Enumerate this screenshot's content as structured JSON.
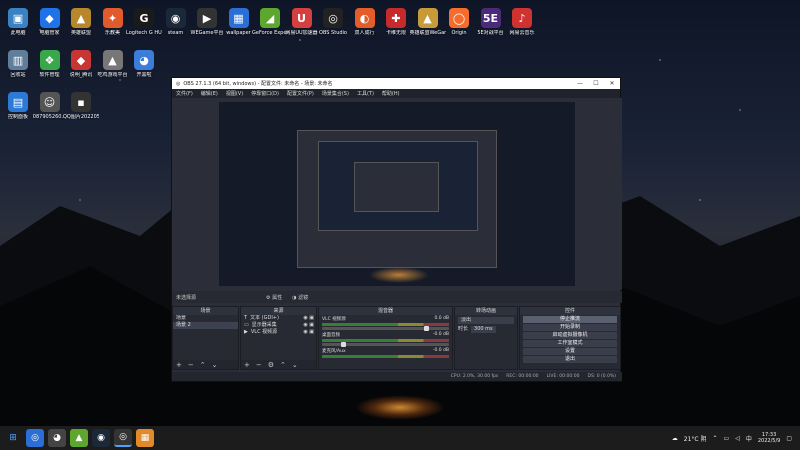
{
  "desktop": {
    "icons_row1": [
      {
        "label": "此电脑",
        "glyph": "▣",
        "color": "#3b82c4"
      },
      {
        "label": "电脑管家",
        "glyph": "◆",
        "color": "#1e73e8"
      },
      {
        "label": "英雄联盟",
        "glyph": "▲",
        "color": "#b8862b"
      },
      {
        "label": "乐教美",
        "glyph": "✦",
        "color": "#e05a2b"
      },
      {
        "label": "Logitech G HUB",
        "glyph": "G",
        "color": "#1a1a1a"
      },
      {
        "label": "steam",
        "glyph": "◉",
        "color": "#1b2838"
      },
      {
        "label": "WEGame平台",
        "glyph": "▶",
        "color": "#333"
      },
      {
        "label": "wallpaper",
        "glyph": "▦",
        "color": "#2b6fd6"
      },
      {
        "label": "GeForce Experience",
        "glyph": "◢",
        "color": "#5da72e"
      },
      {
        "label": "网易UU加速器",
        "glyph": "U",
        "color": "#d63f3f"
      },
      {
        "label": "OBS Studio",
        "glyph": "◎",
        "color": "#222"
      },
      {
        "label": "双人成行",
        "glyph": "◐",
        "color": "#e35d2a"
      },
      {
        "label": "卡维无限",
        "glyph": "✚",
        "color": "#c72a2a"
      },
      {
        "label": "英雄联盟WeGame版",
        "glyph": "▲",
        "color": "#c79b3a"
      },
      {
        "label": "Origin",
        "glyph": "◯",
        "color": "#f56c2d"
      },
      {
        "label": "5E对战平台",
        "glyph": "5E",
        "color": "#4b2a7a"
      },
      {
        "label": "网易云音乐",
        "glyph": "♪",
        "color": "#d0332f"
      }
    ],
    "icons_row2": [
      {
        "label": "回收站",
        "glyph": "▥",
        "color": "#607d9a"
      },
      {
        "label": "软件管理",
        "glyph": "❖",
        "color": "#3aa84a"
      },
      {
        "label": "说明_腾讯",
        "glyph": "◆",
        "color": "#c73535"
      },
      {
        "label": "吃鸡游戏平台",
        "glyph": "▲",
        "color": "#777"
      },
      {
        "label": "开黑啦",
        "glyph": "◕",
        "color": "#3b7dd8"
      }
    ],
    "icons_row3": [
      {
        "label": "控制面板",
        "glyph": "▤",
        "color": "#2d7ad6"
      },
      {
        "label": "087905260...",
        "glyph": "☺",
        "color": "#555"
      },
      {
        "label": "QQ图片20220509...",
        "glyph": "▪",
        "color": "#333"
      }
    ]
  },
  "obs": {
    "title": "OBS 27.1.3 (64 bit, windows) - 配置文件: 未命名 - 场景: 未命名",
    "menu": [
      "文件(F)",
      "编辑(E)",
      "视图(V)",
      "停靠窗口(D)",
      "配置文件(P)",
      "场景集合(S)",
      "工具(T)",
      "帮助(H)"
    ],
    "scene_bar": {
      "label": "未选择源",
      "props": "属性",
      "filters": "滤镜"
    },
    "docks": {
      "scenes": {
        "title": "场景",
        "items": [
          "场景",
          "场景 2"
        ]
      },
      "sources": {
        "title": "来源",
        "items": [
          {
            "icon": "T",
            "label": "文本 (GDI+)"
          },
          {
            "icon": "▭",
            "label": "显示器采集"
          },
          {
            "icon": "▶",
            "label": "VLC 视频源"
          }
        ]
      },
      "mixer": {
        "title": "混音器",
        "channels": [
          {
            "name": "VLC 视频源",
            "db": "0.0 dB"
          },
          {
            "name": "桌面音频",
            "db": "-0.0 dB"
          },
          {
            "name": "麦克风/Aux",
            "db": "-0.0 dB"
          }
        ]
      },
      "transitions": {
        "title": "转场动画",
        "type": "淡出",
        "duration_label": "时长",
        "duration": "300 ms"
      },
      "controls": {
        "title": "控件",
        "buttons": [
          "停止推流",
          "开始录制",
          "启动虚拟摄像机",
          "工作室模式",
          "设置",
          "退出"
        ]
      }
    },
    "status": [
      "CPU: 2.0%, 30.00 fps",
      "REC: 00:00:00",
      "LIVE: 00:00:00",
      "DS: 0 (0.0%)"
    ]
  },
  "taskbar": {
    "items": [
      "⊞",
      "◎",
      "◕",
      "▲",
      "◉",
      "◎",
      "▦"
    ],
    "weather": "21°C 阴",
    "time": "17:33",
    "date": "2022/5/9"
  }
}
